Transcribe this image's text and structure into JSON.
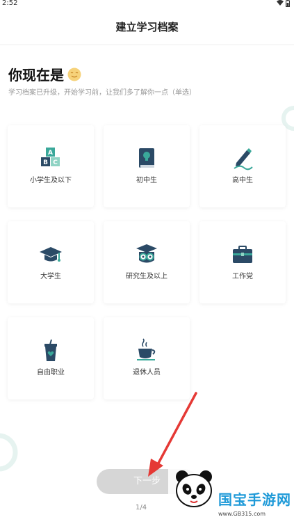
{
  "status_bar": {
    "time": "2:52",
    "icons": [
      "wifi-icon",
      "battery-icon"
    ]
  },
  "header": {
    "title": "建立学习档案"
  },
  "question": {
    "title": "你现在是",
    "emoji": "smile-emoji",
    "subtitle": "学习档案已升级，开始学习前，让我们多了解你一点（单选）"
  },
  "options": [
    {
      "label": "小学生及以下",
      "icon": "abc-blocks-icon"
    },
    {
      "label": "初中生",
      "icon": "book-bulb-icon"
    },
    {
      "label": "高中生",
      "icon": "pen-writing-icon"
    },
    {
      "label": "大学生",
      "icon": "graduation-cap-icon"
    },
    {
      "label": "研究生及以上",
      "icon": "owl-graduate-icon"
    },
    {
      "label": "工作党",
      "icon": "briefcase-icon"
    },
    {
      "label": "自由职业",
      "icon": "drink-cup-icon"
    },
    {
      "label": "退休人员",
      "icon": "tea-cup-icon"
    }
  ],
  "footer": {
    "next_label": "下一步",
    "page_indicator": "1/4"
  },
  "watermark": {
    "name": "国宝手游网",
    "site": "www.GB315.com"
  },
  "colors": {
    "accent": "#3aa89a",
    "dark": "#2b4a66",
    "button_disabled": "#d6d6d6",
    "arrow": "#e53935"
  }
}
